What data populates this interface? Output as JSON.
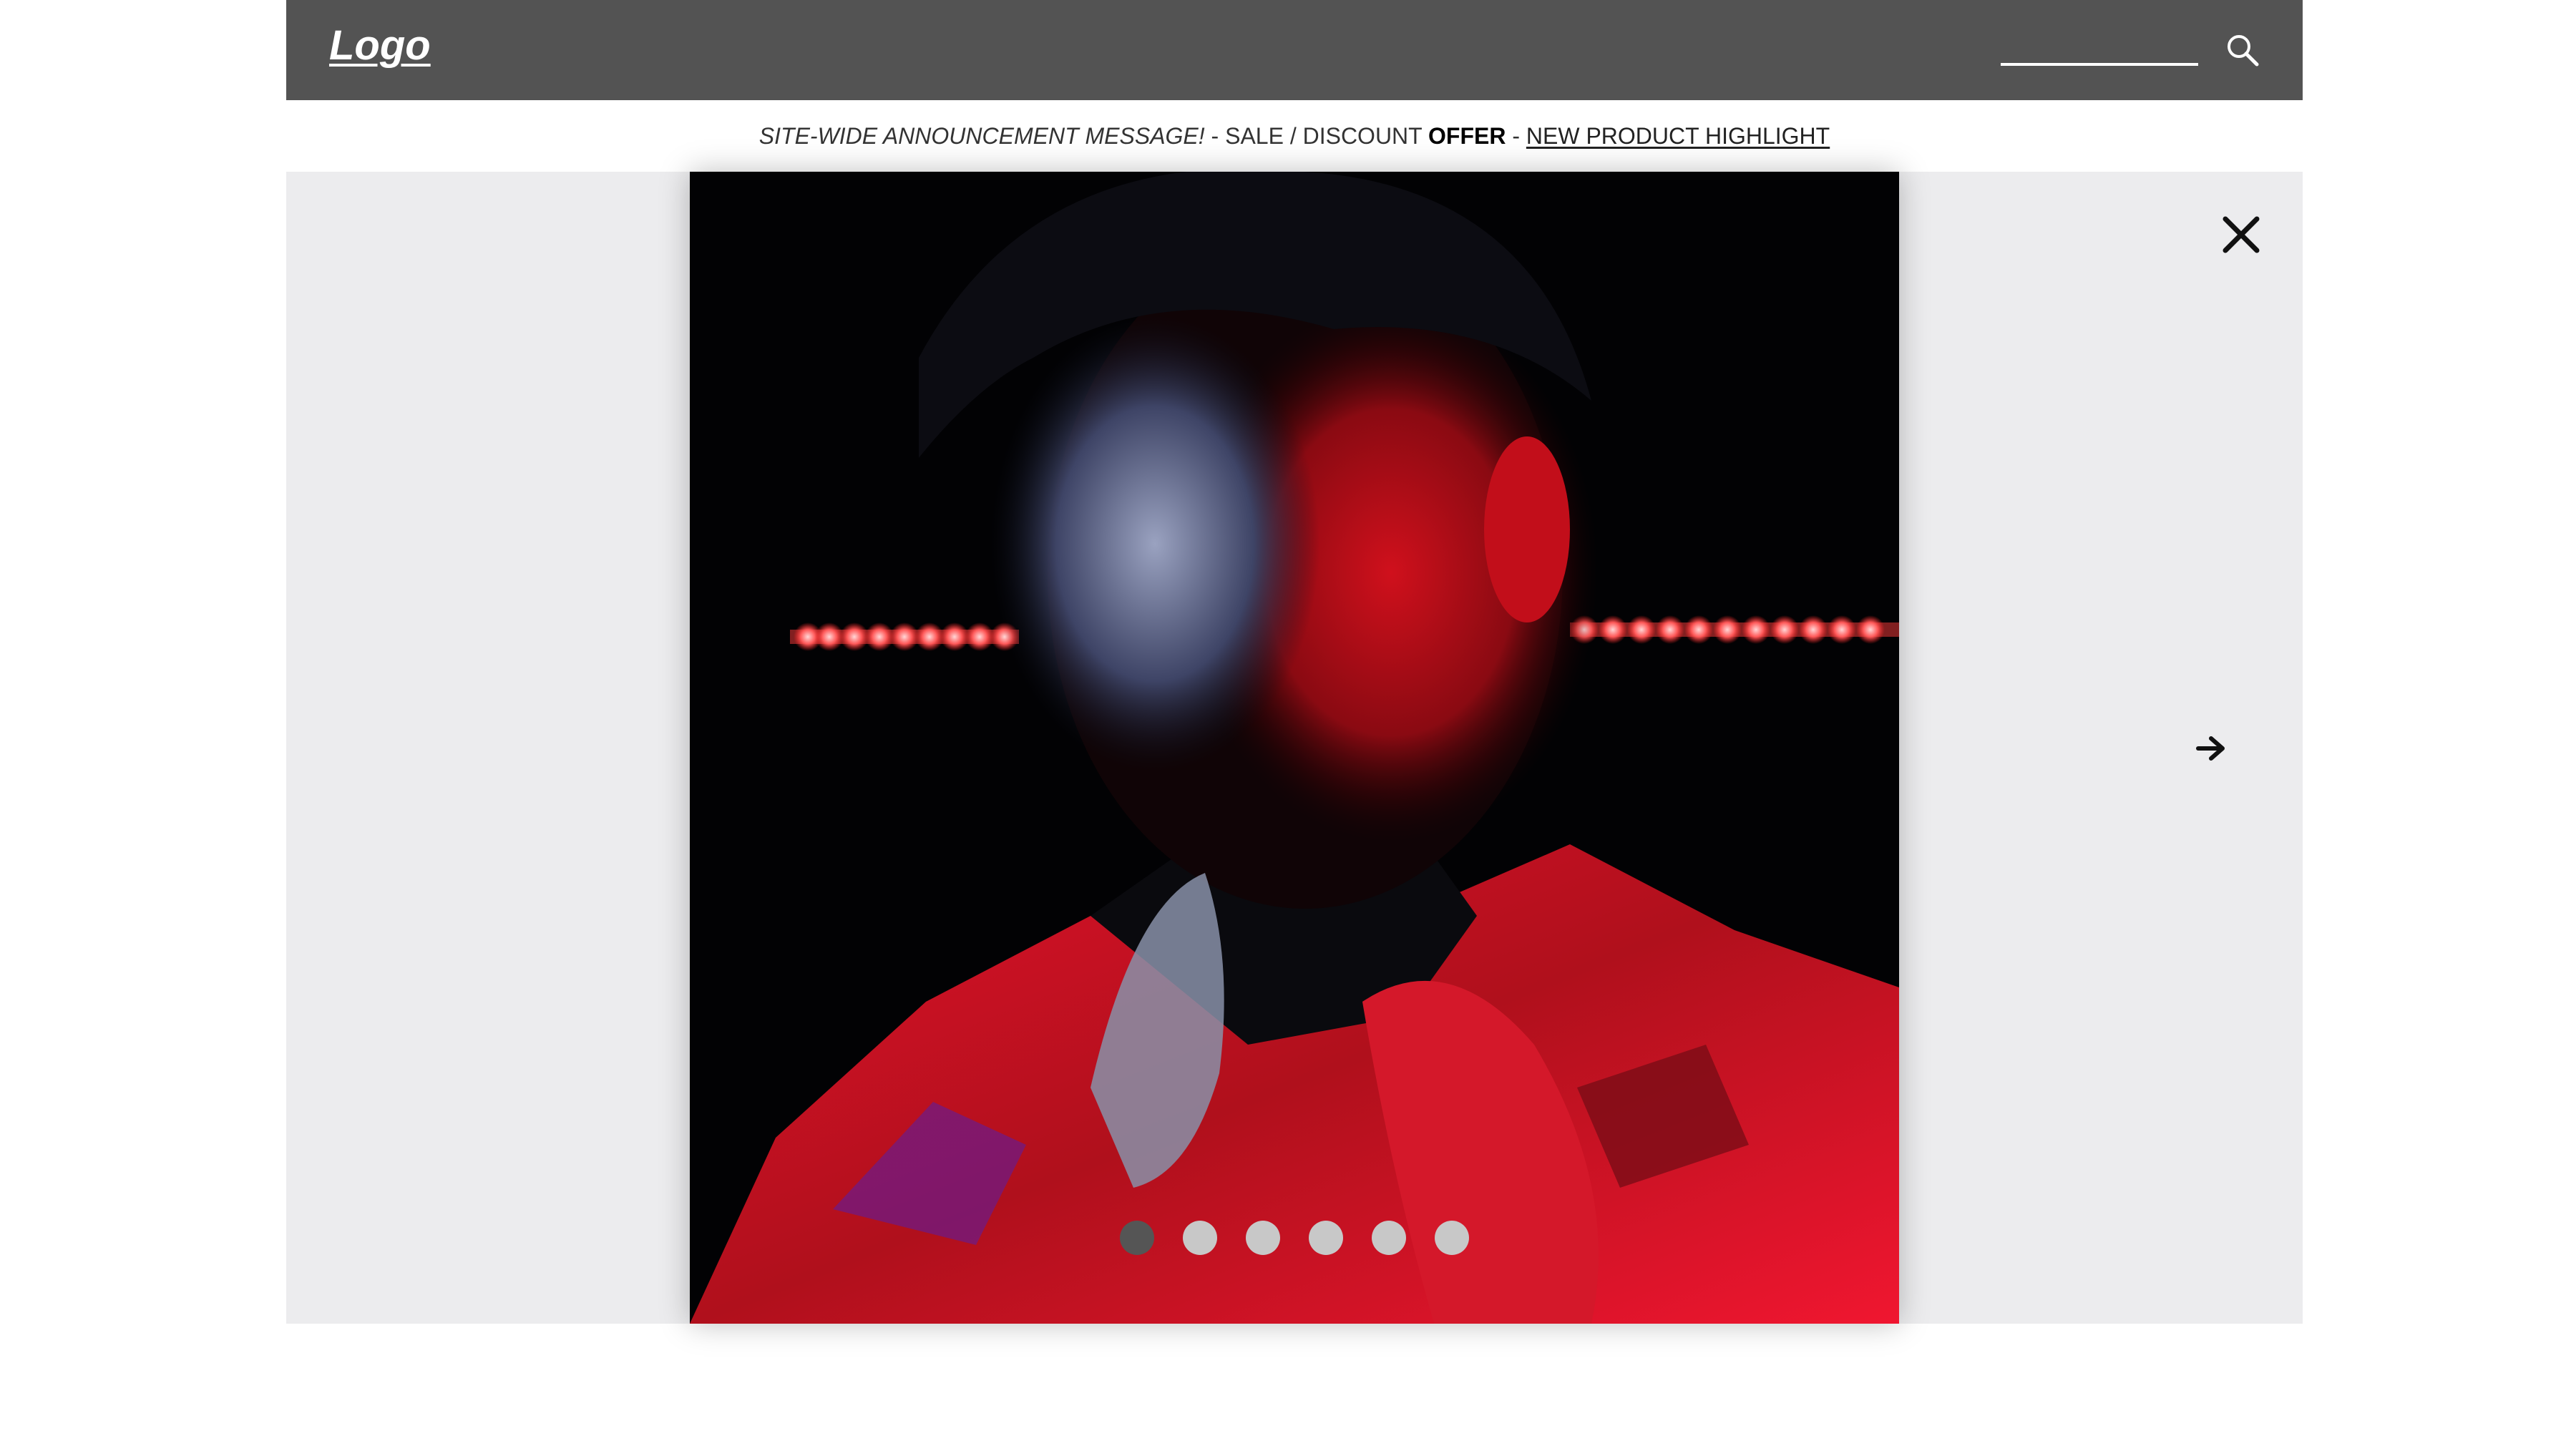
{
  "header": {
    "logo_text": "Logo",
    "search": {
      "value": "",
      "placeholder": ""
    },
    "search_icon": "search-icon"
  },
  "announcement": {
    "part1": "SITE-WIDE ANNOUNCEMENT MESSAGE!",
    "sep1": " - SALE / DISCOUNT ",
    "part2": "OFFER",
    "sep2": " - ",
    "link": "NEW PRODUCT HIGHLIGHT"
  },
  "gallery": {
    "close_icon": "close-icon",
    "next_icon": "arrow-right-icon",
    "active_index": 0,
    "dot_count": 6,
    "colors": {
      "backdrop": "#ececee",
      "dot_active": "#555555",
      "dot_inactive": "#c8c8c8"
    }
  },
  "colors": {
    "header_bg": "#535353",
    "text": "#333333"
  }
}
